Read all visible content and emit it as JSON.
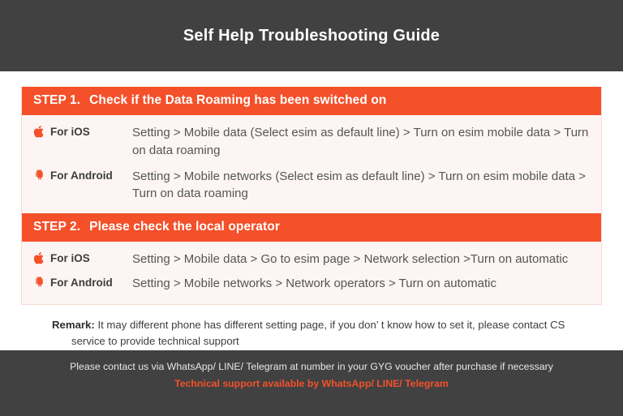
{
  "header": {
    "title": "Self Help Troubleshooting Guide"
  },
  "colors": {
    "accent": "#F4502A",
    "dark_bar": "#414141",
    "card_bg": "#FCF5F3",
    "card_border": "#F7D9D2",
    "body_text": "#555555"
  },
  "steps": [
    {
      "number": "STEP 1.",
      "title": "Check if the Data Roaming has been switched on",
      "rows": [
        {
          "icon": "apple-icon",
          "os": "For iOS",
          "instructions": "Setting > Mobile data (Select esim as default line) > Turn on esim mobile data > Turn on data roaming"
        },
        {
          "icon": "android-icon",
          "os": "For Android",
          "instructions": "Setting > Mobile networks (Select esim as default line) > Turn on esim mobile data > Turn on data roaming"
        }
      ]
    },
    {
      "number": "STEP 2.",
      "title": "Please check the local operator",
      "rows": [
        {
          "icon": "apple-icon",
          "os": "For iOS",
          "instructions": "Setting > Mobile data > Go to esim page > Network selection >Turn on automatic"
        },
        {
          "icon": "android-icon",
          "os": "For Android",
          "instructions": "Setting > Mobile networks > Network operators > Turn on automatic"
        }
      ]
    }
  ],
  "remark": {
    "label": "Remark:",
    "text": " It may different phone has different setting page, if you don’ t know how to set it,  please contact CS",
    "text_line2": "service to provide technical support"
  },
  "footer": {
    "line1": "Please contact us via WhatsApp/ LINE/ Telegram at number in your GYG voucher after purchase if necessary",
    "line2": "Technical support available by WhatsApp/ LINE/ Telegram"
  }
}
